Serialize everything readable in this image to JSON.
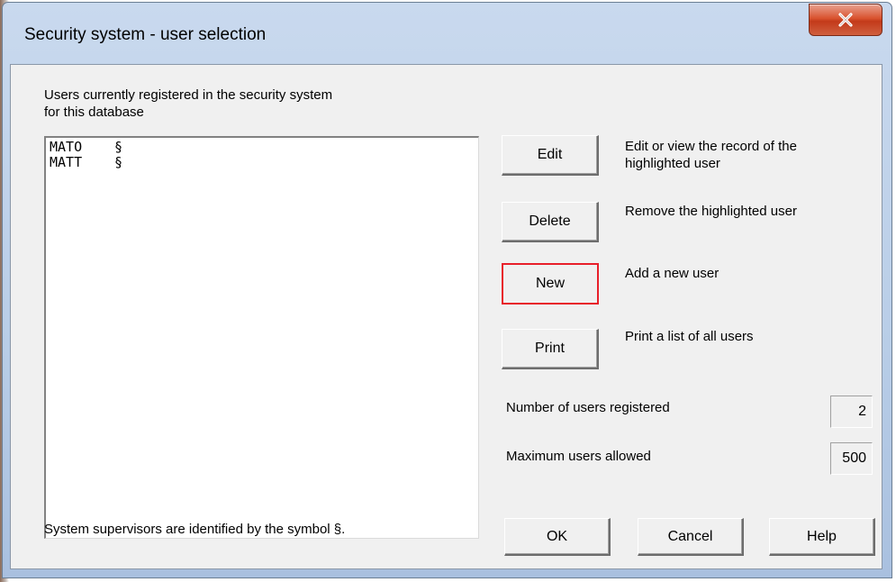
{
  "window": {
    "title": "Security system - user selection",
    "close_glyph": "X"
  },
  "users_header": {
    "line1": "Users currently registered in the security system",
    "line2": "for this database"
  },
  "users": [
    {
      "name": "MATO",
      "marker": "§"
    },
    {
      "name": "MATT",
      "marker": "§"
    }
  ],
  "actions": [
    {
      "label": "Edit",
      "description_line1": "Edit or view the record of the",
      "description_line2": "highlighted user"
    },
    {
      "label": "Delete",
      "description_line1": "Remove the highlighted user",
      "description_line2": ""
    },
    {
      "label": "New",
      "description_line1": "Add a new user",
      "description_line2": ""
    },
    {
      "label": "Print",
      "description_line1": "Print a list of all users",
      "description_line2": ""
    }
  ],
  "stats": {
    "registered_label": "Number of users registered",
    "registered_value": "2",
    "max_label": "Maximum users allowed",
    "max_value": "500"
  },
  "footer_note": "System supervisors are identified by the symbol §.",
  "buttons": {
    "ok": "OK",
    "cancel": "Cancel",
    "help": "Help"
  },
  "colors": {
    "focus_border": "#e81f2a",
    "close_button": "#c33a1a",
    "titlebar": "#b8cde7"
  }
}
